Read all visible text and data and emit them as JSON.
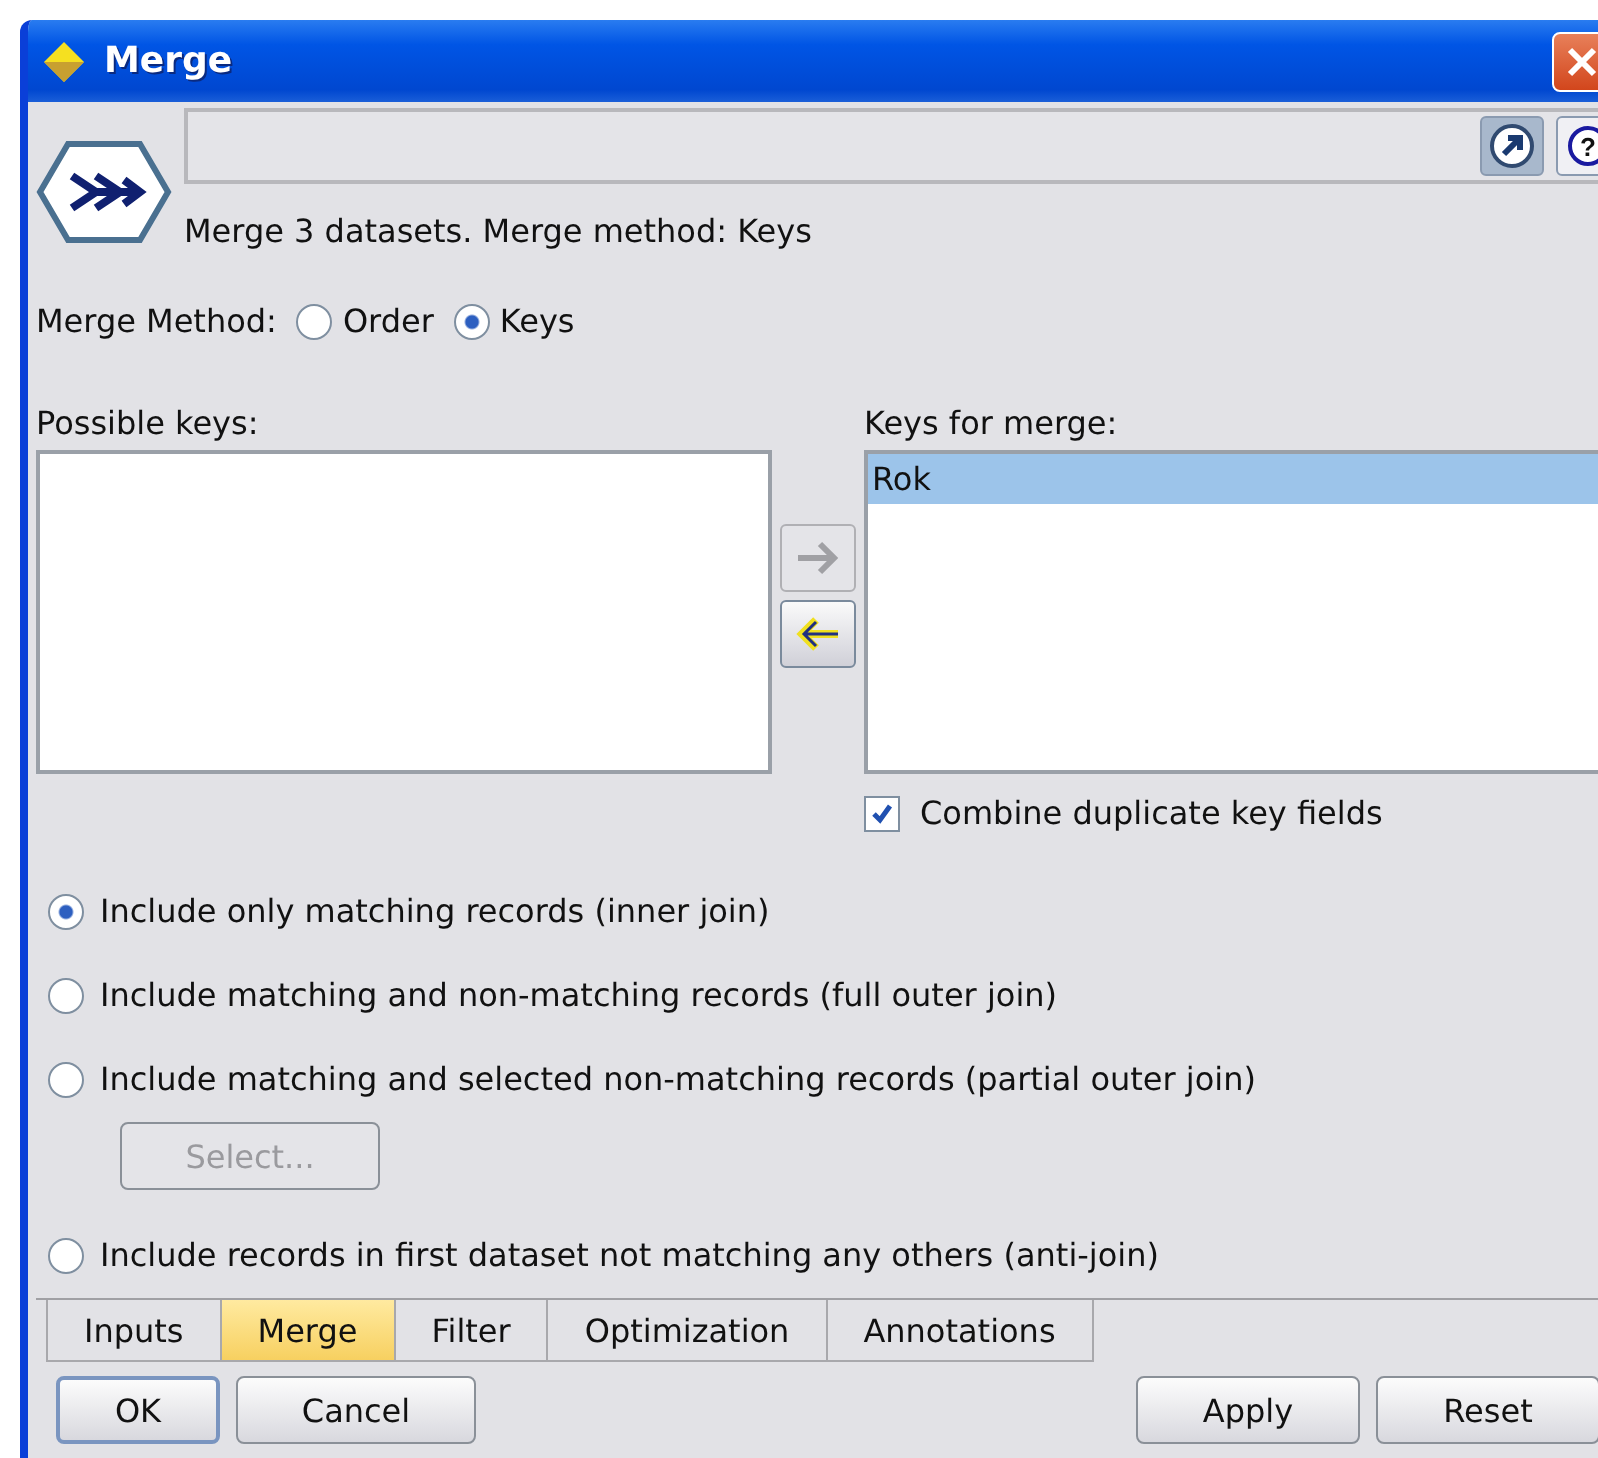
{
  "window": {
    "title": "Merge"
  },
  "header": {
    "description": "Merge 3 datasets. Merge method: Keys",
    "help_button": {
      "label": "?"
    }
  },
  "merge_method": {
    "label": "Merge Method:",
    "options": [
      {
        "label": "Order",
        "selected": false
      },
      {
        "label": "Keys",
        "selected": true
      }
    ]
  },
  "possible_keys": {
    "label": "Possible keys:"
  },
  "move_buttons": [
    {
      "kind": "right",
      "disabled": true
    },
    {
      "kind": "left",
      "disabled": false
    }
  ],
  "keys_for_merge": {
    "label": "Keys for merge:",
    "items": [
      {
        "label": "Rok",
        "selected": true
      }
    ]
  },
  "combine_duplicates": {
    "label": "Combine duplicate key fields",
    "checked": true
  },
  "join_options": [
    {
      "label": "Include only matching records (inner join)",
      "selected": true
    },
    {
      "label": "Include matching and non-matching records (full outer join)",
      "selected": false
    },
    {
      "label": "Include matching and selected non-matching records (partial outer join)",
      "selected": false,
      "button": {
        "label": "Select...",
        "disabled": true
      }
    },
    {
      "label": "Include records in first dataset not matching any others (anti-join)",
      "selected": false
    }
  ],
  "tabs": [
    {
      "label": "Inputs",
      "selected": false
    },
    {
      "label": "Merge",
      "selected": true
    },
    {
      "label": "Filter",
      "selected": false
    },
    {
      "label": "Optimization",
      "selected": false
    },
    {
      "label": "Annotations",
      "selected": false
    }
  ],
  "buttons_left": [
    {
      "label": "OK",
      "default": true
    },
    {
      "label": "Cancel",
      "default": false
    }
  ],
  "buttons_right": [
    {
      "label": "Apply",
      "default": false
    },
    {
      "label": "Reset",
      "default": false
    }
  ]
}
